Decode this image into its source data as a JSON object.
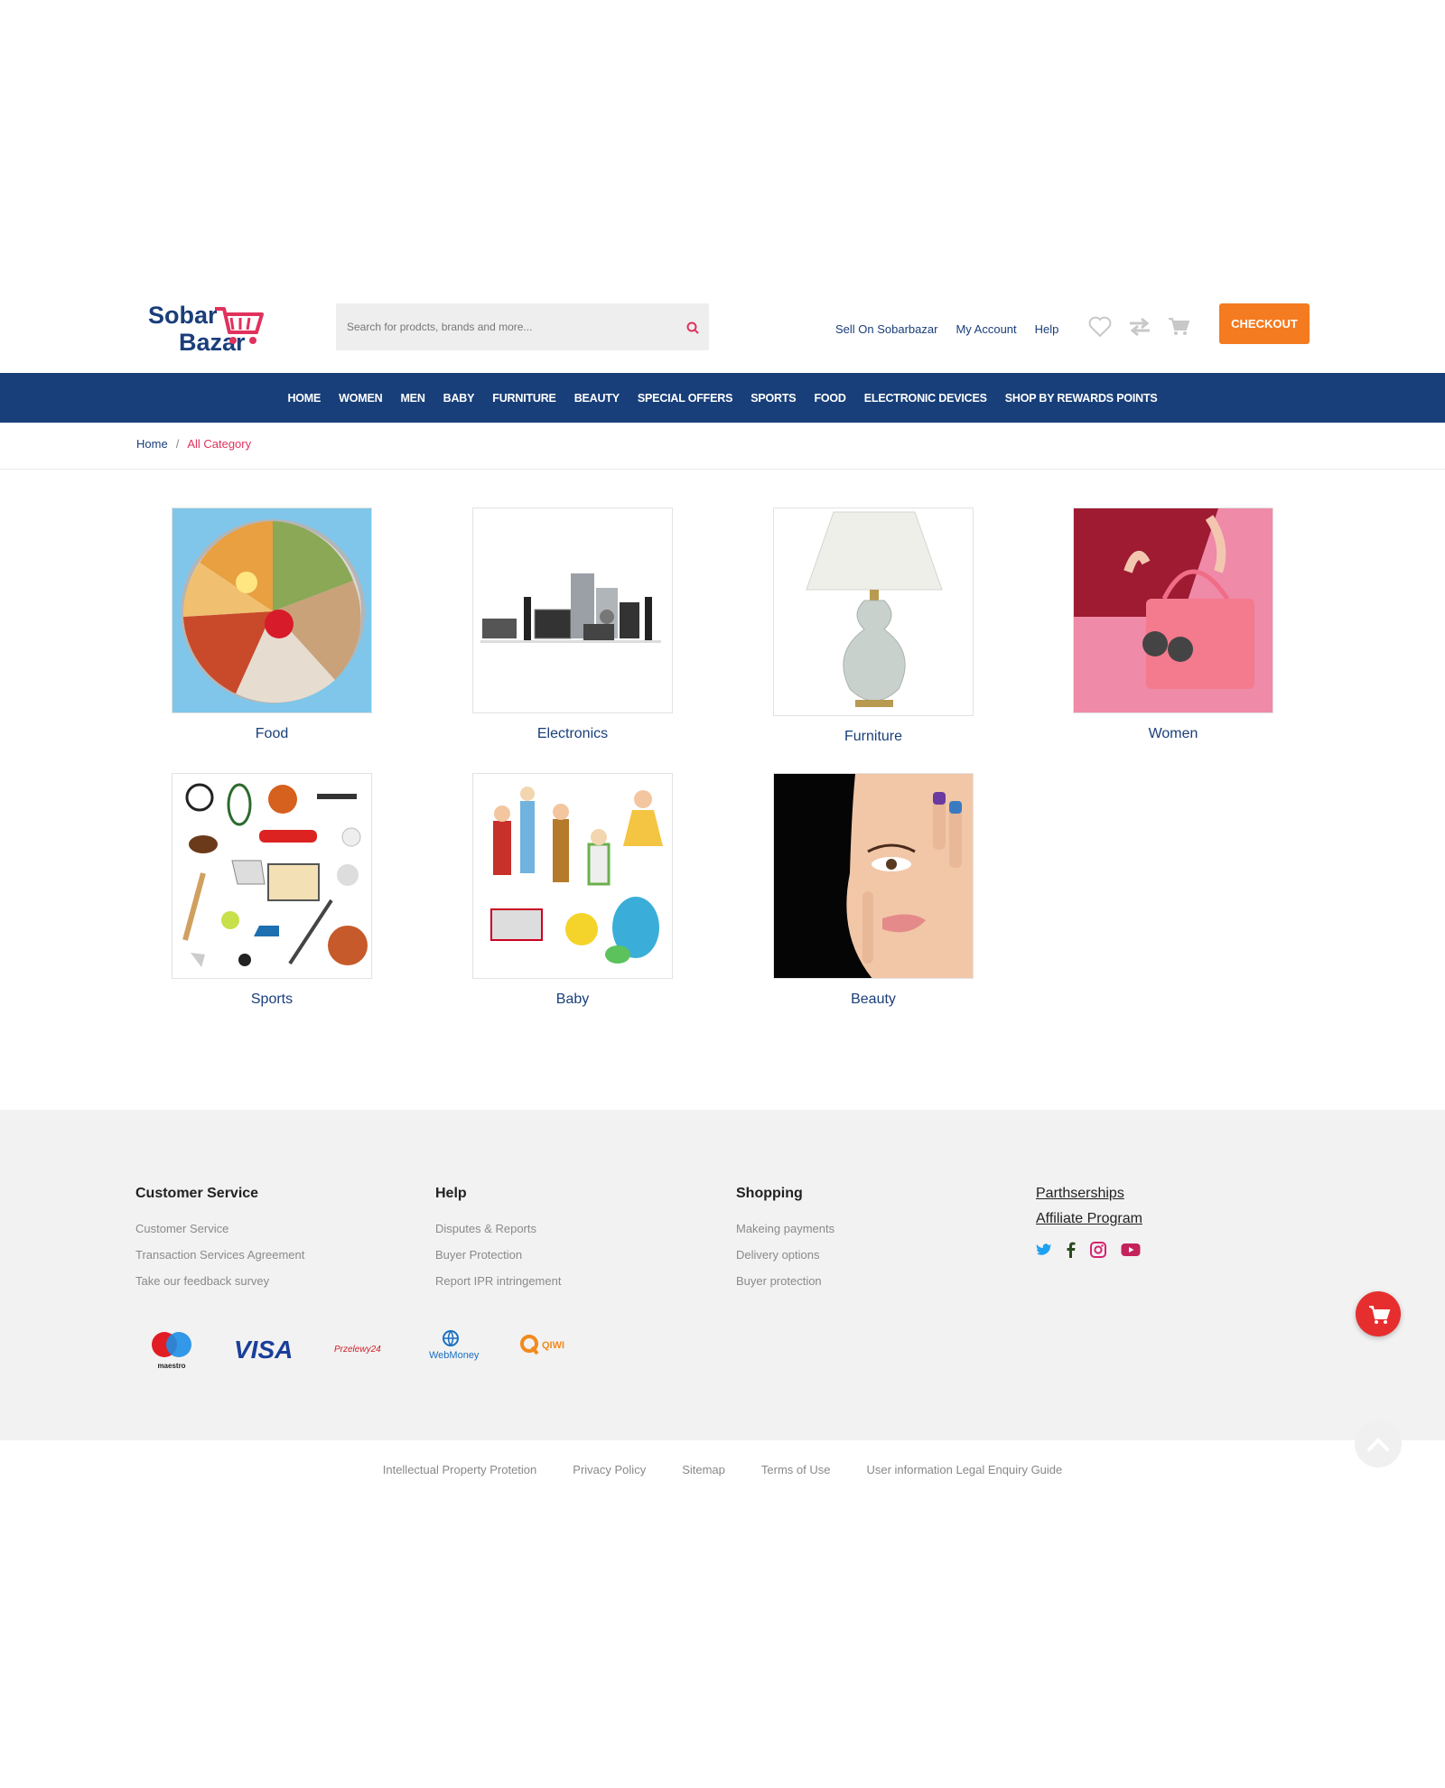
{
  "logo": {
    "line1": "Sobar",
    "line2": "Bazar"
  },
  "search": {
    "placeholder": "Search for prodcts, brands and more..."
  },
  "header_links": {
    "sell": "Sell On Sobarbazar",
    "account": "My Account",
    "help": "Help"
  },
  "checkout_label": "CHECKOUT",
  "nav": [
    "HOME",
    "WOMEN",
    "MEN",
    "BABY",
    "FURNITURE",
    "BEAUTY",
    "SPECIAL OFFERS",
    "SPORTS",
    "FOOD",
    "ELECTRONIC DEVICES",
    "SHOP BY REWARDS POINTS"
  ],
  "breadcrumb": {
    "home": "Home",
    "sep": "/",
    "current": "All Category"
  },
  "categories": [
    {
      "label": "Food"
    },
    {
      "label": "Electronics"
    },
    {
      "label": "Furniture"
    },
    {
      "label": "Women"
    },
    {
      "label": "Sports"
    },
    {
      "label": "Baby"
    },
    {
      "label": "Beauty"
    }
  ],
  "footer": {
    "customer_service": {
      "title": "Customer Service",
      "links": [
        "Customer Service",
        "Transaction Services Agreement",
        "Take our feedback survey"
      ]
    },
    "help": {
      "title": "Help",
      "links": [
        "Disputes & Reports",
        "Buyer Protection",
        "Report IPR intringement"
      ]
    },
    "shopping": {
      "title": "Shopping",
      "links": [
        "Makeing payments",
        "Delivery options",
        "Buyer protection"
      ]
    },
    "partner_links": [
      "Parthserships",
      "Affiliate Program"
    ],
    "payments": {
      "maestro": "maestro",
      "visa": "VISA",
      "przelewy": "Przelewy24",
      "webmoney": "WebMoney",
      "qiwi": "QIWI"
    }
  },
  "bottom_links": [
    "Intellectual Property Protetion",
    "Privacy Policy",
    "Sitemap",
    "Terms of Use",
    "User information Legal Enquiry Guide"
  ],
  "colors": {
    "brand_blue": "#183f79",
    "checkout_orange": "#f47b20",
    "accent_red": "#e62e2e",
    "breadcrumb_active": "#e0325c"
  },
  "icons": [
    "search-icon",
    "wishlist-heart-icon",
    "compare-arrows-icon",
    "cart-icon",
    "twitter-icon",
    "facebook-icon",
    "instagram-icon",
    "youtube-icon",
    "floating-cart-icon",
    "scroll-up-icon"
  ]
}
